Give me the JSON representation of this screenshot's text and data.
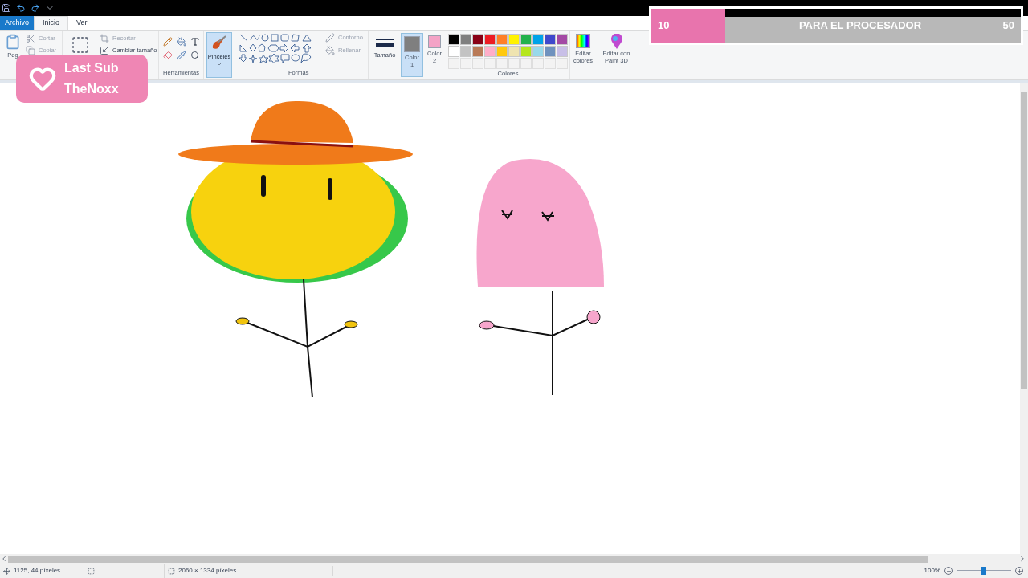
{
  "tabs": [
    {
      "label": "Archivo",
      "kind": "file",
      "selected": false
    },
    {
      "label": "Inicio",
      "kind": "tab",
      "selected": true
    },
    {
      "label": "Ver",
      "kind": "tab",
      "selected": false
    }
  ],
  "ribbon": {
    "clipboard": {
      "paste": "Peg",
      "cut": "Cortar",
      "copy": "Copiar"
    },
    "image": {
      "crop": "Recortar",
      "resize": "Cambiar tamaño"
    },
    "tools": {
      "label": "Herramientas"
    },
    "brushes": {
      "label": "Pinceles",
      "selected": true
    },
    "shapes": {
      "outline": "Contorno",
      "fill": "Rellenar",
      "label": "Formas"
    },
    "size": {
      "label": "Tamaño"
    },
    "colors": {
      "slots": [
        {
          "label": "Color",
          "index": "1",
          "color": "#7f7f7f",
          "selected": true
        },
        {
          "label": "Color",
          "index": "2",
          "color": "#f4a3c6",
          "selected": false
        }
      ],
      "palette": [
        {
          "color": "#000000"
        },
        {
          "color": "#7f7f7f"
        },
        {
          "color": "#880015"
        },
        {
          "color": "#ed1c24"
        },
        {
          "color": "#ff7f27"
        },
        {
          "color": "#fff200"
        },
        {
          "color": "#22b14c"
        },
        {
          "color": "#00a2e8"
        },
        {
          "color": "#3f48cc"
        },
        {
          "color": "#a349a4"
        },
        {
          "color": "#ffffff"
        },
        {
          "color": "#c3c3c3"
        },
        {
          "color": "#b97a57"
        },
        {
          "color": "#ffaec9"
        },
        {
          "color": "#ffc90e"
        },
        {
          "color": "#efe4b0"
        },
        {
          "color": "#b5e61d"
        },
        {
          "color": "#99d9ea"
        },
        {
          "color": "#7092be"
        },
        {
          "color": "#c8bfe7"
        }
      ],
      "edit": "Editar colores",
      "label": "Colores"
    },
    "paint3d": "Editar con Paint 3D"
  },
  "overlay_badge": {
    "title": "Last Sub",
    "name": "TheNoxx"
  },
  "goal": {
    "start": "10",
    "label": "PARA EL PROCESADOR",
    "end": "50",
    "level": 0.2
  },
  "status_bar": {
    "cursor": "1125, 44 píxeles",
    "size": "2060 × 1334 píxeles",
    "zoom": "100%",
    "level": 0.5
  }
}
